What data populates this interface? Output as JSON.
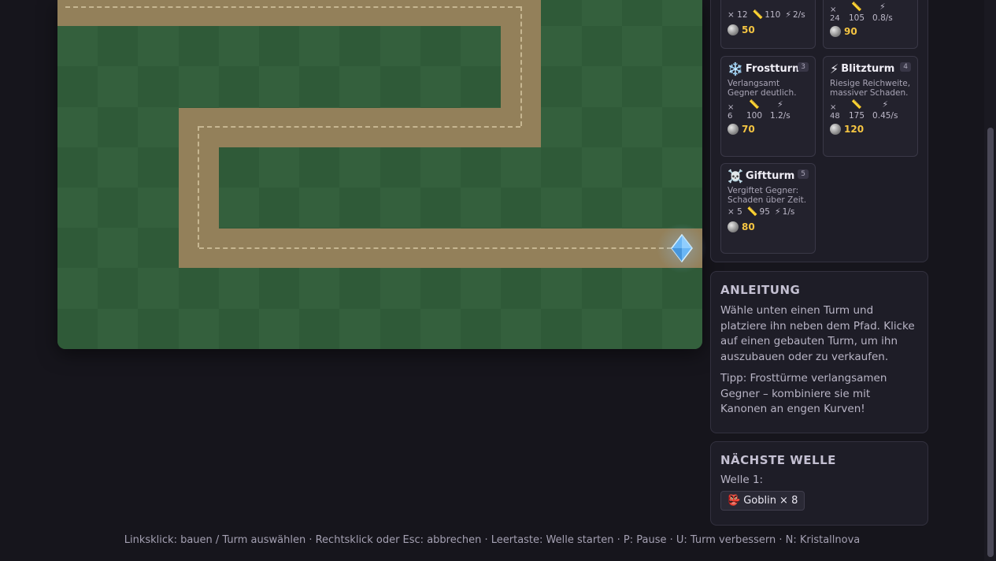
{
  "game": {
    "colors": {
      "grass_a": "#2f5a38",
      "grass_b": "#34603d",
      "path": "#93805a",
      "crystal": "#6ab6f5"
    },
    "crystal_icon": "diamond-crystal-icon"
  },
  "towers": [
    {
      "id": "top-left",
      "name": "",
      "icon": "",
      "hotkey": "",
      "desc": "",
      "stat1": "× 12",
      "stat2": "110",
      "stat3": "2/s",
      "price": "50"
    },
    {
      "id": "top-right",
      "name": "",
      "icon": "",
      "hotkey": "",
      "desc": "",
      "stat1": "× 24",
      "stat2": "105",
      "stat3": "0.8/s",
      "price": "90"
    },
    {
      "id": "frost",
      "name": "Frostturm",
      "icon": "❄️",
      "hotkey": "3",
      "desc": "Verlangsamt Gegner deutlich.",
      "stat1": "× 6",
      "stat2": "100",
      "stat3": "1.2/s",
      "price": "70"
    },
    {
      "id": "lightning",
      "name": "Blitzturm",
      "icon": "⚡",
      "hotkey": "4",
      "desc": "Riesige Reichweite, massiver Schaden.",
      "stat1": "× 48",
      "stat2": "175",
      "stat3": "0.45/s",
      "price": "120"
    },
    {
      "id": "poison",
      "name": "Giftturm",
      "icon": "☠️",
      "hotkey": "5",
      "desc": "Vergiftet Gegner: Schaden über Zeit.",
      "stat1": "× 5",
      "stat2": "95",
      "stat3": "1/s",
      "price": "80"
    }
  ],
  "guide": {
    "title": "ANLEITUNG",
    "text1": "Wähle unten einen Turm und platziere ihn neben dem Pfad. Klicke auf einen gebauten Turm, um ihn auszubauen oder zu verkaufen.",
    "text2": "Tipp: Frosttürme verlangsamen Gegner – kombiniere sie mit Kanonen an engen Kurven!"
  },
  "next_wave": {
    "title": "NÄCHSTE WELLE",
    "label": "Welle 1:",
    "enemy_icon": "👺",
    "enemy": "Goblin × 8"
  },
  "footer": "Linksklick: bauen / Turm auswählen · Rechtsklick oder Esc: abbrechen · Leertaste: Welle starten · P: Pause · U: Turm verbessern · N: Kristallnova"
}
